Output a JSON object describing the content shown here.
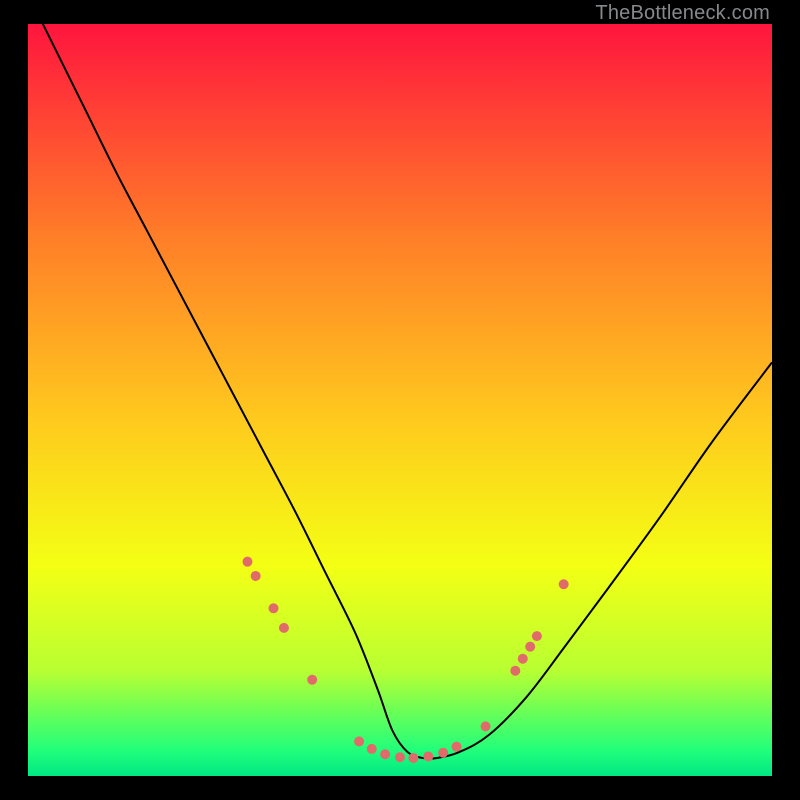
{
  "watermark": "TheBottleneck.com",
  "chart_data": {
    "type": "line",
    "title": "",
    "xlabel": "",
    "ylabel": "",
    "xlim": [
      0,
      100
    ],
    "ylim": [
      0,
      100
    ],
    "grid": false,
    "legend": false,
    "background_gradient": {
      "stops": [
        {
          "pos": 0.0,
          "color": "#ff153e"
        },
        {
          "pos": 0.28,
          "color": "#ff7d28"
        },
        {
          "pos": 0.52,
          "color": "#ffc81e"
        },
        {
          "pos": 0.72,
          "color": "#f4ff14"
        },
        {
          "pos": 0.86,
          "color": "#b8ff32"
        },
        {
          "pos": 0.965,
          "color": "#22ff7a"
        },
        {
          "pos": 1.0,
          "color": "#00e884"
        }
      ]
    },
    "series": [
      {
        "name": "bottleneck-curve",
        "stroke": "#000000",
        "x": [
          0,
          4,
          8,
          12,
          16,
          20,
          24,
          28,
          32,
          36,
          40,
          44,
          47,
          49,
          51,
          53,
          55,
          58,
          62,
          67,
          72,
          78,
          85,
          92,
          100
        ],
        "values": [
          104,
          96,
          88,
          80,
          72.5,
          65,
          57.5,
          50,
          42.5,
          35,
          27,
          19,
          11.5,
          6,
          3.2,
          2.4,
          2.4,
          3.2,
          5.5,
          10.5,
          17,
          25,
          34.5,
          44.5,
          55
        ]
      }
    ],
    "markers": {
      "name": "highlight-dots",
      "color": "#e16a6a",
      "points": [
        {
          "x": 29.5,
          "y": 28.5,
          "r": 5
        },
        {
          "x": 30.6,
          "y": 26.6,
          "r": 5
        },
        {
          "x": 33.0,
          "y": 22.3,
          "r": 5
        },
        {
          "x": 34.4,
          "y": 19.7,
          "r": 5
        },
        {
          "x": 38.2,
          "y": 12.8,
          "r": 5
        },
        {
          "x": 44.5,
          "y": 4.6,
          "r": 5
        },
        {
          "x": 46.2,
          "y": 3.6,
          "r": 5
        },
        {
          "x": 48.0,
          "y": 2.9,
          "r": 5
        },
        {
          "x": 50.0,
          "y": 2.5,
          "r": 5
        },
        {
          "x": 51.8,
          "y": 2.4,
          "r": 5
        },
        {
          "x": 53.8,
          "y": 2.6,
          "r": 5
        },
        {
          "x": 55.8,
          "y": 3.1,
          "r": 5
        },
        {
          "x": 57.6,
          "y": 3.9,
          "r": 5
        },
        {
          "x": 61.5,
          "y": 6.6,
          "r": 5
        },
        {
          "x": 65.5,
          "y": 14.0,
          "r": 5
        },
        {
          "x": 66.5,
          "y": 15.6,
          "r": 5
        },
        {
          "x": 67.5,
          "y": 17.2,
          "r": 5
        },
        {
          "x": 68.4,
          "y": 18.6,
          "r": 5
        },
        {
          "x": 72.0,
          "y": 25.5,
          "r": 5
        }
      ]
    }
  }
}
